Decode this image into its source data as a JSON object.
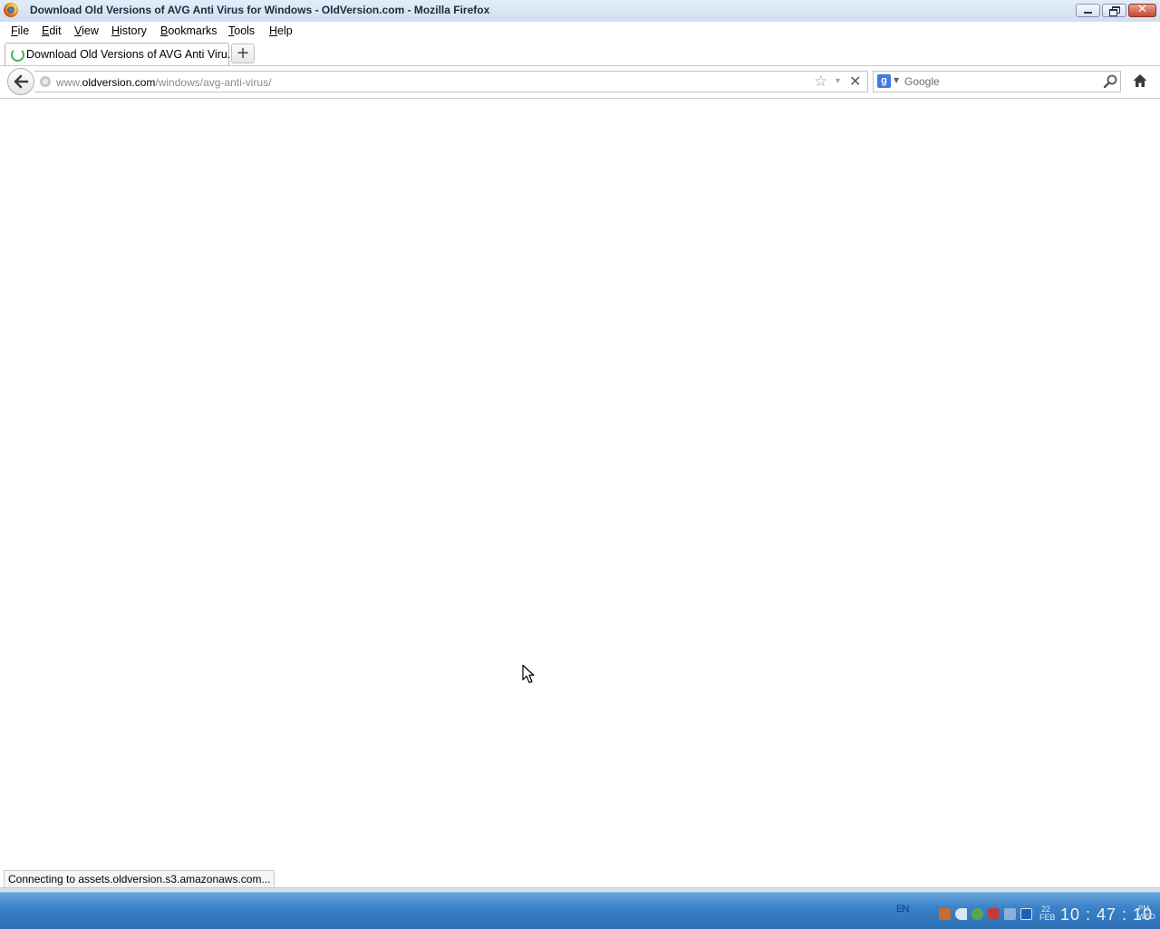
{
  "window": {
    "title": "Download Old Versions of AVG Anti Virus for Windows - OldVersion.com - Mozilla Firefox",
    "controls": {
      "minimize_icon": "minimize-icon",
      "restore_icon": "restore-icon",
      "close_icon": "close-icon",
      "close_glyph": "✕"
    }
  },
  "menu": {
    "file": "File",
    "edit": "Edit",
    "view": "View",
    "history": "History",
    "bookmarks": "Bookmarks",
    "tools": "Tools",
    "help": "Help"
  },
  "tabs": {
    "active": {
      "title": "Download Old Versions of AVG Anti Viru...",
      "loading": true
    },
    "new_tab_glyph": "+"
  },
  "navbar": {
    "url_prefix": "www.",
    "url_domain": "oldversion.com",
    "url_path": "/windows/avg-anti-virus/",
    "search_engine_icon": "g",
    "search_placeholder": "Google",
    "star_glyph": "☆",
    "dropdown_glyph": "▾",
    "stop_glyph": "✕"
  },
  "status": {
    "text": "Connecting to assets.oldversion.s3.amazonaws.com..."
  },
  "taskbar": {
    "language": "EN",
    "date_day": "22",
    "date_month": "FEB",
    "time": "10 : 47 : 10",
    "ampm": "PM",
    "weekday": "WED"
  },
  "colors": {
    "titlebar": "#cfdff2",
    "taskbar": "#3b82c8",
    "loading_spinner": "#42b34d"
  }
}
